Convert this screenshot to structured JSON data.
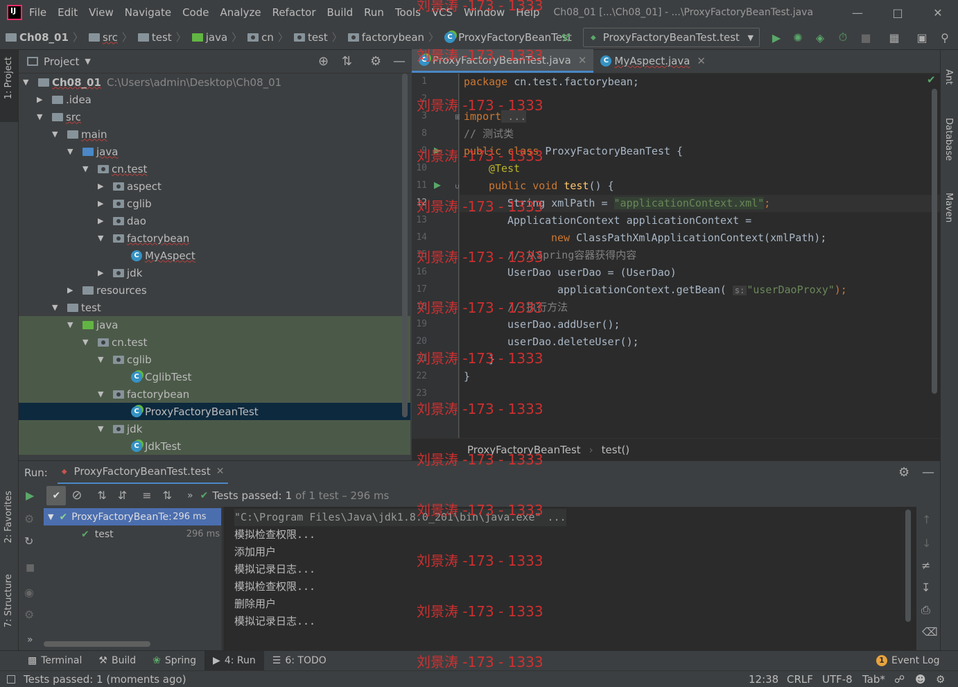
{
  "menu": {
    "items": [
      "File",
      "Edit",
      "View",
      "Navigate",
      "Code",
      "Analyze",
      "Refactor",
      "Build",
      "Run",
      "Tools",
      "VCS",
      "Window",
      "Help"
    ],
    "window_title": "Ch08_01 [...\\Ch08_01] - ...\\ProxyFactoryBeanTest.java"
  },
  "breadcrumb": [
    "Ch08_01",
    "src",
    "test",
    "java",
    "cn",
    "test",
    "factorybean",
    "ProxyFactoryBeanTest"
  ],
  "run_config": "ProxyFactoryBeanTest.test",
  "project_panel": {
    "title": "Project",
    "root_label": "Ch08_01",
    "root_path": "C:\\Users\\admin\\Desktop\\Ch08_01",
    "nodes": [
      {
        "label": ".idea"
      },
      {
        "label": "src"
      },
      {
        "label": "main"
      },
      {
        "label": "java"
      },
      {
        "label": "cn.test"
      },
      {
        "label": "aspect"
      },
      {
        "label": "cglib"
      },
      {
        "label": "dao"
      },
      {
        "label": "factorybean"
      },
      {
        "label": "MyAspect"
      },
      {
        "label": "jdk"
      },
      {
        "label": "resources"
      },
      {
        "label": "test"
      },
      {
        "label": "java"
      },
      {
        "label": "cn.test"
      },
      {
        "label": "cglib"
      },
      {
        "label": "CglibTest"
      },
      {
        "label": "factorybean"
      },
      {
        "label": "ProxyFactoryBeanTest"
      },
      {
        "label": "jdk"
      },
      {
        "label": "JdkTest"
      }
    ]
  },
  "editor": {
    "tabs": [
      "ProxyFactoryBeanTest.java",
      "MyAspect.java"
    ],
    "line_numbers": [
      "1",
      "2",
      "3",
      "8",
      "9",
      "10",
      "11",
      "12",
      "13",
      "14",
      "15",
      "16",
      "17",
      "18",
      "19",
      "20",
      "21",
      "22",
      "23"
    ],
    "lines": {
      "l1_kw": "package",
      "l1_rest": " cn.test.factorybean;",
      "l3_kw": "import",
      "l3_rest": " ...",
      "l8": "// 测试类",
      "l9_kw": "public class",
      "l9_rest": " ProxyFactoryBeanTest {",
      "l10": "@Test",
      "l11_kw": "public void",
      "l11_fn": "test",
      "l11_rest": "() {",
      "l12_a": "String xmlPath = ",
      "l12_s": "\"applicationContext.xml\"",
      "l12_b": ";",
      "l13": "ApplicationContext applicationContext =",
      "l14_kw": "new",
      "l14_rest": " ClassPathXmlApplicationContext(xmlPath);",
      "l15": "// 从Spring容器获得内容",
      "l16": "UserDao userDao = (UserDao)",
      "l17_a": "applicationContext.getBean(",
      "l17_hint": "s:",
      "l17_s": "\"userDaoProxy\"",
      "l17_b": ");",
      "l18": "// 执行方法",
      "l19": "userDao.addUser();",
      "l20": "userDao.deleteUser();",
      "l21": "}",
      "l22": "}"
    },
    "footer_crumb": [
      "ProxyFactoryBeanTest",
      "test()"
    ]
  },
  "run_panel": {
    "label": "Run:",
    "tab": "ProxyFactoryBeanTest.test",
    "status_prefix": "Tests passed:",
    "status_count": "1",
    "status_suffix": "of 1 test – 296 ms",
    "tree": [
      {
        "label": "ProxyFactoryBeanTe:",
        "time": "296 ms"
      },
      {
        "label": "test",
        "time": "296 ms"
      }
    ],
    "console": [
      "\"C:\\Program Files\\Java\\jdk1.8.0_201\\bin\\java.exe\" ...",
      "模拟检查权限...",
      "添加用户",
      "模拟记录日志...",
      "模拟检查权限...",
      "删除用户",
      "模拟记录日志..."
    ]
  },
  "side_tabs": {
    "left": [
      "1: Project",
      "2: Favorites",
      "7: Structure"
    ],
    "right": [
      "Ant",
      "Database",
      "Maven"
    ]
  },
  "tool_windows": [
    "Terminal",
    "Build",
    "Spring",
    "4: Run",
    "6: TODO"
  ],
  "event_log": {
    "badge": "1",
    "label": "Event Log"
  },
  "status": {
    "message": "Tests passed: 1 (moments ago)",
    "position": "12:38",
    "line_sep": "CRLF",
    "encoding": "UTF-8",
    "indent": "Tab*"
  },
  "watermark": "刘景涛 -173 - 1333"
}
